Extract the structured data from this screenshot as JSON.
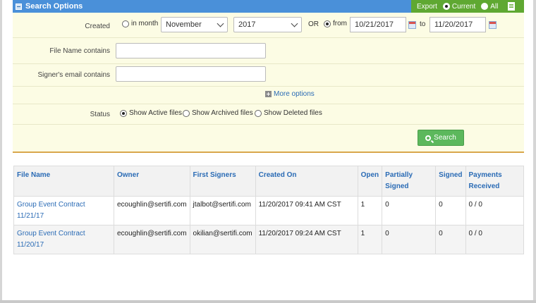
{
  "header": {
    "title": "Search Options",
    "export_label": "Export",
    "export_options": [
      {
        "label": "Current",
        "checked": true
      },
      {
        "label": "All",
        "checked": false
      }
    ]
  },
  "filters": {
    "created_label": "Created",
    "in_month_label": "in month",
    "in_month_checked": false,
    "month_value": "November",
    "year_value": "2017",
    "or_label": "OR",
    "from_label": "from",
    "from_checked": true,
    "from_date": "10/21/2017",
    "to_label": "to",
    "to_date": "11/20/2017",
    "file_name_label": "File Name contains",
    "file_name_value": "",
    "signer_email_label": "Signer's email contains",
    "signer_email_value": "",
    "more_options_label": "More options",
    "status_label": "Status",
    "status_options": [
      {
        "label": "Show Active files",
        "checked": true
      },
      {
        "label": "Show Archived files",
        "checked": false
      },
      {
        "label": "Show Deleted files",
        "checked": false
      }
    ],
    "search_button_label": "Search"
  },
  "results": {
    "columns": [
      "File Name",
      "Owner",
      "First Signers",
      "Created On",
      "Open",
      "Partially Signed",
      "Signed",
      "Payments Received"
    ],
    "rows": [
      {
        "file_name": "Group Event Contract 11/21/17",
        "owner": "ecoughlin@sertifi.com",
        "first_signer": "jtalbot@sertifi.com",
        "created_on": "11/20/2017 09:41 AM CST",
        "open": "1",
        "partially_signed": "0",
        "signed": "0",
        "payments": "0 / 0"
      },
      {
        "file_name": "Group Event Contract 11/20/17",
        "owner": "ecoughlin@sertifi.com",
        "first_signer": "okilian@sertifi.com",
        "created_on": "11/20/2017 09:24 AM CST",
        "open": "1",
        "partially_signed": "0",
        "signed": "0",
        "payments": "0 / 0"
      }
    ]
  },
  "colors": {
    "header_blue": "#4a90d9",
    "export_green": "#5fa832",
    "panel_bg": "#fcfce4",
    "link_blue": "#2a6bb5",
    "search_green": "#5cb85c"
  }
}
